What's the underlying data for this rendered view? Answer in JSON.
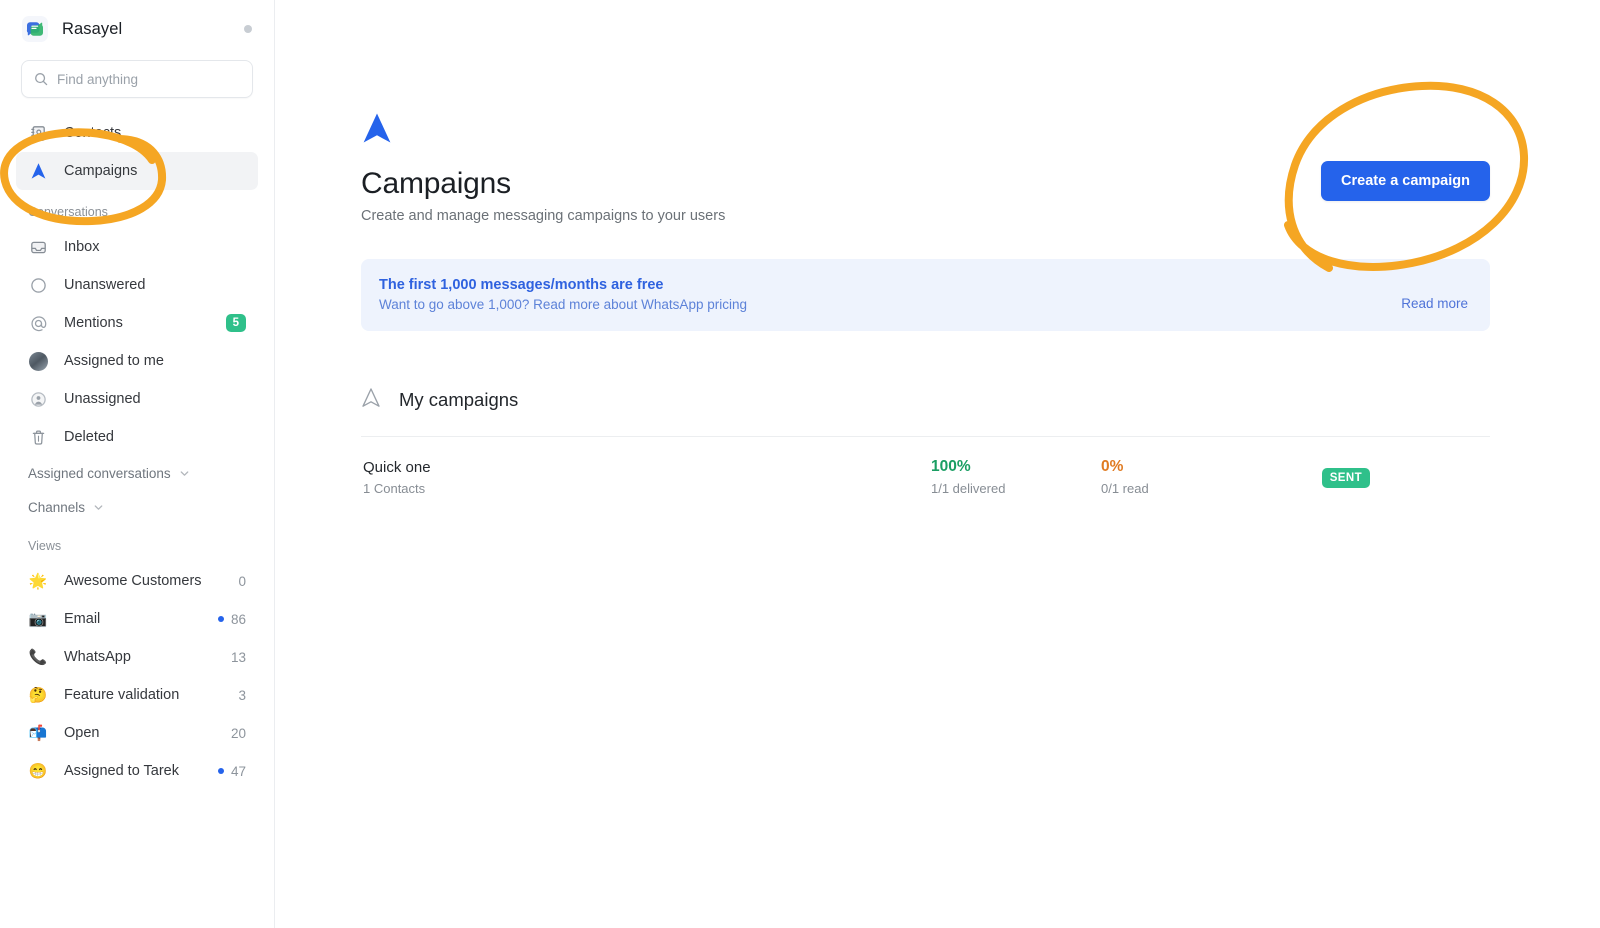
{
  "app": {
    "brand_name": "Rasayel",
    "brand_logo_icon": "rasayel-logo-icon",
    "status_dot_color": "#c8cdd3"
  },
  "search": {
    "placeholder": "Find anything",
    "value": "",
    "icon": "search-icon"
  },
  "sidebar": {
    "top_items": [
      {
        "label": "Contacts",
        "icon": "contacts-book-icon",
        "active": false,
        "count": ""
      },
      {
        "label": "Campaigns",
        "icon": "campaign-arrow-icon",
        "active": true,
        "count": ""
      }
    ],
    "conversations_label": "Conversations",
    "conversation_items": [
      {
        "label": "Inbox",
        "icon": "inbox-tray-icon",
        "count": "",
        "dot": false,
        "badge": ""
      },
      {
        "label": "Unanswered",
        "icon": "circle-outline-icon",
        "count": "",
        "dot": false,
        "badge": ""
      },
      {
        "label": "Mentions",
        "icon": "at-sign-icon",
        "count": "",
        "dot": false,
        "badge": "5"
      },
      {
        "label": "Assigned to me",
        "icon": "user-avatar-icon",
        "count": "",
        "dot": false,
        "badge": ""
      },
      {
        "label": "Unassigned",
        "icon": "user-circle-icon",
        "count": "",
        "dot": false,
        "badge": ""
      },
      {
        "label": "Deleted",
        "icon": "trash-icon",
        "count": "",
        "dot": false,
        "badge": ""
      }
    ],
    "collapsibles": [
      {
        "label": "Assigned conversations",
        "icon": "chevron-down-icon"
      },
      {
        "label": "Channels",
        "icon": "chevron-down-icon"
      }
    ],
    "views_label": "Views",
    "view_items": [
      {
        "label": "Awesome Customers",
        "emoji": "🌟",
        "icon": "star-emoji-icon",
        "count": "0",
        "dot": false
      },
      {
        "label": "Email",
        "emoji": "📷",
        "icon": "camera-emoji-icon",
        "count": "86",
        "dot": true
      },
      {
        "label": "WhatsApp",
        "emoji": "📞",
        "icon": "phone-emoji-icon",
        "count": "13",
        "dot": false
      },
      {
        "label": "Feature validation",
        "emoji": "🤔",
        "icon": "thinking-face-emoji-icon",
        "count": "3",
        "dot": false
      },
      {
        "label": "Open",
        "emoji": "📬",
        "icon": "mailbox-emoji-icon",
        "count": "20",
        "dot": false
      },
      {
        "label": "Assigned to Tarek",
        "emoji": "😁",
        "icon": "grinning-face-emoji-icon",
        "count": "47",
        "dot": true
      }
    ]
  },
  "main": {
    "page_icon": "campaign-arrow-icon",
    "title": "Campaigns",
    "subtitle": "Create and manage messaging campaigns to your users",
    "cta_label": "Create a campaign",
    "banner": {
      "title": "The first 1,000 messages/months are free",
      "subtitle": "Want to go above 1,000? Read more about WhatsApp pricing",
      "link_label": "Read more"
    },
    "section": {
      "icon": "campaign-outline-icon",
      "title": "My campaigns"
    },
    "campaigns": [
      {
        "name": "Quick one",
        "contacts": "1 Contacts",
        "delivered_pct": "100%",
        "delivered_sub": "1/1 delivered",
        "read_pct": "0%",
        "read_sub": "0/1 read",
        "status": "SENT"
      }
    ]
  },
  "annotations": {
    "highlight_color": "#f5a623",
    "circles": [
      {
        "target": "sidebar-item-campaigns"
      },
      {
        "target": "create-a-campaign-button"
      }
    ]
  },
  "colors": {
    "accent_blue": "#2563eb",
    "banner_bg": "#eef3fd",
    "banner_text": "#2f62df",
    "success_green": "#1a9e63",
    "badge_green": "#2fc08a",
    "warning_orange": "#e07b22",
    "annotation_orange": "#f5a623"
  }
}
